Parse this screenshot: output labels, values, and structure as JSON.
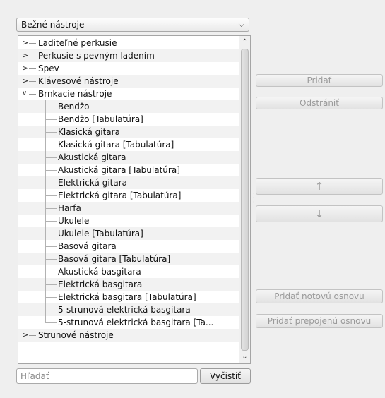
{
  "combo": {
    "value": "Bežné nástroje",
    "arrow_icon": "chevron-down-icon"
  },
  "tree": {
    "top_items": {
      "t0": "Laditeľné perkusie",
      "t1": "Perkusie s pevným ladením",
      "t2": "Spev",
      "t3": "Klávesové nástroje",
      "t4": "Brnkacie nástroje",
      "t5": "Strunové nástroje"
    },
    "children": [
      "Bendžo",
      "Bendžo [Tabulatúra]",
      "Klasická gitara",
      "Klasická gitara [Tabulatúra]",
      "Akustická gitara",
      "Akustická gitara [Tabulatúra]",
      "Elektrická gitara",
      "Elektrická gitara [Tabulatúra]",
      "Harfa",
      "Ukulele",
      "Ukulele [Tabulatúra]",
      "Basová gitara",
      "Basová gitara [Tabulatúra]",
      "Akustická basgitara",
      "Elektrická basgitara",
      "Elektrická basgitara [Tabulatúra]",
      "5-strunová elektrická basgitara",
      "5-strunová elektrická basgitara [Ta..."
    ],
    "expanded_glyph": "⌄",
    "collapsed_glyph": "›"
  },
  "search": {
    "placeholder": "Hľadať",
    "clear_label": "Vyčistiť"
  },
  "buttons": {
    "add": "Pridať",
    "remove": "Odstrániť",
    "up": "↑",
    "down": "↓",
    "add_staff": "Pridať notovú osnovu",
    "add_linked_staff": "Pridať prepojenú osnovu"
  }
}
